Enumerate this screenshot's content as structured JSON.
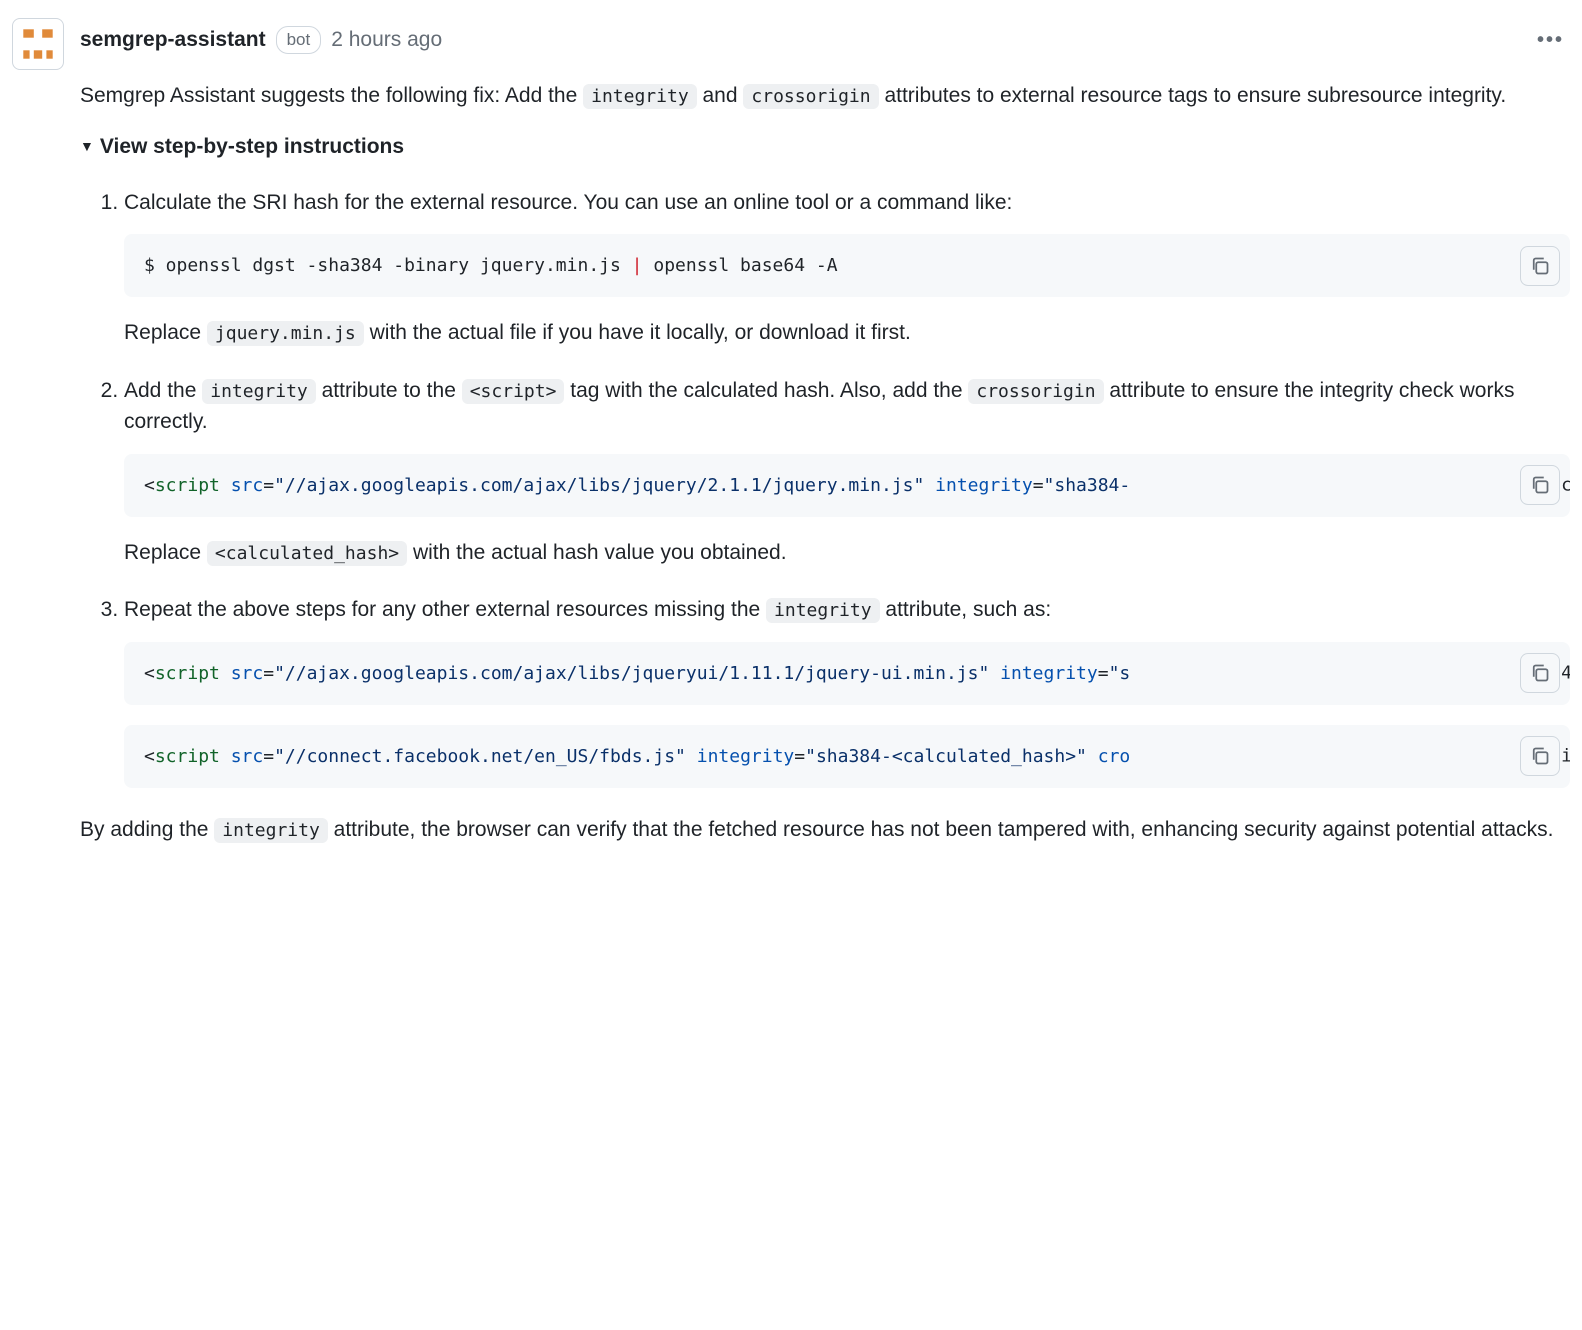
{
  "header": {
    "username": "semgrep-assistant",
    "bot_label": "bot",
    "timestamp": "2 hours ago"
  },
  "intro": {
    "p1a": "Semgrep Assistant suggests the following fix: Add the ",
    "code1": "integrity",
    "p1b": " and ",
    "code2": "crossorigin",
    "p1c": " attributes to external resource tags to ensure subresource integrity."
  },
  "details_summary": "View step-by-step instructions",
  "step1": {
    "text": "Calculate the SRI hash for the external resource. You can use an online tool or a command like:",
    "code": {
      "prefix": "$ openssl dgst -sha384 -binary jquery.min.js ",
      "pipe": "|",
      "suffix": " openssl base64 -A"
    },
    "after_a": "Replace ",
    "after_code": "jquery.min.js",
    "after_b": " with the actual file if you have it locally, or download it first."
  },
  "step2": {
    "t_a": "Add the ",
    "t_code1": "integrity",
    "t_b": " attribute to the ",
    "t_code2": "<script>",
    "t_c": " tag with the calculated hash. Also, add the ",
    "t_code3": "crossorigin",
    "t_d": " attribute to ensure the integrity check works correctly.",
    "code": {
      "tag_open": "<",
      "tag_name": "script",
      "sp": " ",
      "attr_src": "src",
      "eq": "=",
      "val_src": "\"//ajax.googleapis.com/ajax/libs/jquery/2.1.1/jquery.min.js\"",
      "attr_int": "integrity",
      "val_int": "\"sha384-",
      "tail": " c"
    },
    "after_a": "Replace ",
    "after_code": "<calculated_hash>",
    "after_b": " with the actual hash value you obtained."
  },
  "step3": {
    "t_a": "Repeat the above steps for any other external resources missing the ",
    "t_code": "integrity",
    "t_b": " attribute, such as:",
    "code1": {
      "tag_open": "<",
      "tag_name": "script",
      "sp": " ",
      "attr_src": "src",
      "eq": "=",
      "val_src": "\"//ajax.googleapis.com/ajax/libs/jqueryui/1.11.1/jquery-ui.min.js\"",
      "attr_int": "integrity",
      "val_int": "\"s",
      "tail": " 4"
    },
    "code2": {
      "tag_open": "<",
      "tag_name": "script",
      "sp": " ",
      "attr_src": "src",
      "eq": "=",
      "val_src": "\"//connect.facebook.net/en_US/fbds.js\"",
      "attr_int": "integrity",
      "val_int": "\"sha384-<calculated_hash>\"",
      "attr_cro": "cro",
      "tail": " i"
    }
  },
  "closing": {
    "a": "By adding the ",
    "code": "integrity",
    "b": " attribute, the browser can verify that the fetched resource has not been tampered with, enhancing security against potential attacks."
  }
}
